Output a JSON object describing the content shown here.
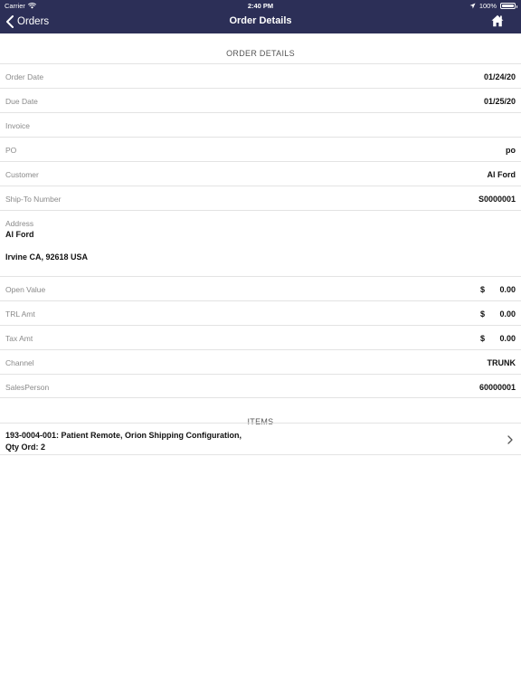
{
  "status_bar": {
    "carrier": "Carrier",
    "time": "2:40 PM",
    "battery": "100%",
    "battery_level": 1.0
  },
  "nav": {
    "back_label": "Orders",
    "title": "Order Details"
  },
  "order_section": {
    "header": "ORDER DETAILS",
    "fields": [
      {
        "label": "Order Date",
        "value": "01/24/20"
      },
      {
        "label": "Due Date",
        "value": "01/25/20"
      },
      {
        "label": "Invoice",
        "value": ""
      },
      {
        "label": "PO",
        "value": "po"
      },
      {
        "label": "Customer",
        "value": "Al Ford"
      },
      {
        "label": "Ship-To Number",
        "value": "S0000001"
      }
    ],
    "address": {
      "label": "Address",
      "name": "Al Ford",
      "city_line": "Irvine CA, 92618 USA"
    },
    "amounts": [
      {
        "label": "Open Value",
        "currency": "$",
        "value": "0.00"
      },
      {
        "label": "TRL Amt",
        "currency": "$",
        "value": "0.00"
      },
      {
        "label": "Tax Amt",
        "currency": "$",
        "value": "0.00"
      }
    ],
    "extra": [
      {
        "label": "Channel",
        "value": "TRUNK"
      },
      {
        "label": "SalesPerson",
        "value": "60000001"
      }
    ]
  },
  "items_section": {
    "header": "ITEMS",
    "items": [
      {
        "title": "193-0004-001: Patient Remote, Orion Shipping Configuration,",
        "qty": "Qty Ord:  2"
      }
    ]
  }
}
